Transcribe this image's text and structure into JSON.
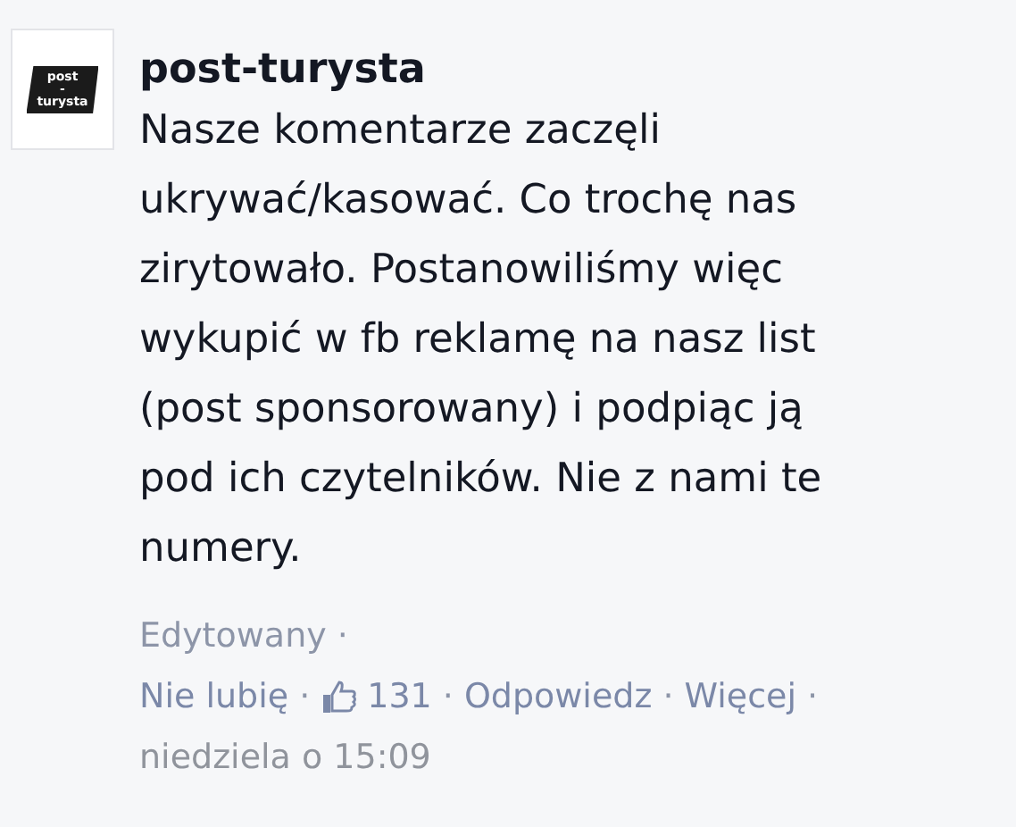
{
  "avatar": {
    "lines": [
      "post",
      "-",
      "turysta"
    ]
  },
  "author": "post-turysta",
  "comment_lines": [
    "Nasze komentarze zaczęli",
    "ukrywać/kasować. Co trochę nas",
    "zirytowało. Postanowiliśmy więc",
    "wykupić w fb reklamę na nasz list",
    "(post sponsorowany) i podpiąc ją",
    "pod ich czytelników. Nie z nami te",
    "numery."
  ],
  "edited": "Edytowany",
  "actions": [
    {
      "kind": "link",
      "label": "Nie lubię"
    },
    {
      "kind": "likes",
      "label": "131"
    },
    {
      "kind": "link",
      "label": "Odpowiedz"
    },
    {
      "kind": "link",
      "label": "Więcej"
    }
  ],
  "separator": "·",
  "timestamp": "niedziela o 15:09"
}
